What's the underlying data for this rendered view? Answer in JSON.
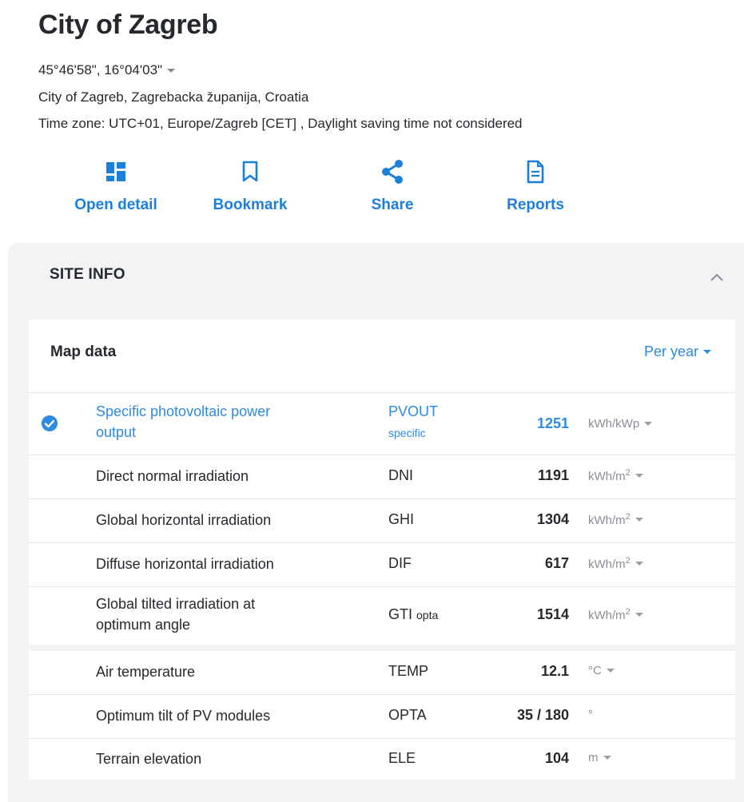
{
  "header": {
    "title": "City of Zagreb",
    "coords": "45°46'58\", 16°04'03\"",
    "location": "City of Zagreb, Zagrebacka županija, Croatia",
    "timezone": "Time zone: UTC+01, Europe/Zagreb [CET] , Daylight saving time not considered"
  },
  "actions": [
    {
      "label": "Open detail",
      "icon": "dashboard-icon"
    },
    {
      "label": "Bookmark",
      "icon": "bookmark-icon"
    },
    {
      "label": "Share",
      "icon": "share-icon"
    },
    {
      "label": "Reports",
      "icon": "document-icon"
    }
  ],
  "site_info": {
    "title": "SITE INFO",
    "card_title": "Map data",
    "period": "Per year",
    "rows": [
      {
        "name_line1": "Specific photovoltaic power",
        "name_line2": "output",
        "code": "PVOUT",
        "code_sub": "specific",
        "value": "1251",
        "unit": "kWh/kWp",
        "unit_sup": "",
        "selected": true
      },
      {
        "name_line1": "Direct normal irradiation",
        "code": "DNI",
        "value": "1191",
        "unit": "kWh/m",
        "unit_sup": "2"
      },
      {
        "name_line1": "Global horizontal irradiation",
        "code": "GHI",
        "value": "1304",
        "unit": "kWh/m",
        "unit_sup": "2"
      },
      {
        "name_line1": "Diffuse horizontal irradiation",
        "code": "DIF",
        "value": "617",
        "unit": "kWh/m",
        "unit_sup": "2"
      },
      {
        "name_line1": "Global tilted irradiation at",
        "name_line2": "optimum angle",
        "code": "GTI",
        "code_sub": "opta",
        "value": "1514",
        "unit": "kWh/m",
        "unit_sup": "2"
      },
      {
        "name_line1": "Air temperature",
        "code": "TEMP",
        "value": "12.1",
        "unit": "°C",
        "unit_sup": ""
      },
      {
        "name_line1": "Optimum tilt of PV modules",
        "code": "OPTA",
        "value": "35 / 180",
        "unit": "°",
        "unit_sup": ""
      },
      {
        "name_line1": "Terrain elevation",
        "code": "ELE",
        "value": "104",
        "unit": "m",
        "unit_sup": ""
      }
    ]
  },
  "colors": {
    "accent": "#1c7fd9",
    "link": "#2c8be0",
    "panel_bg": "#f2f3f5"
  }
}
